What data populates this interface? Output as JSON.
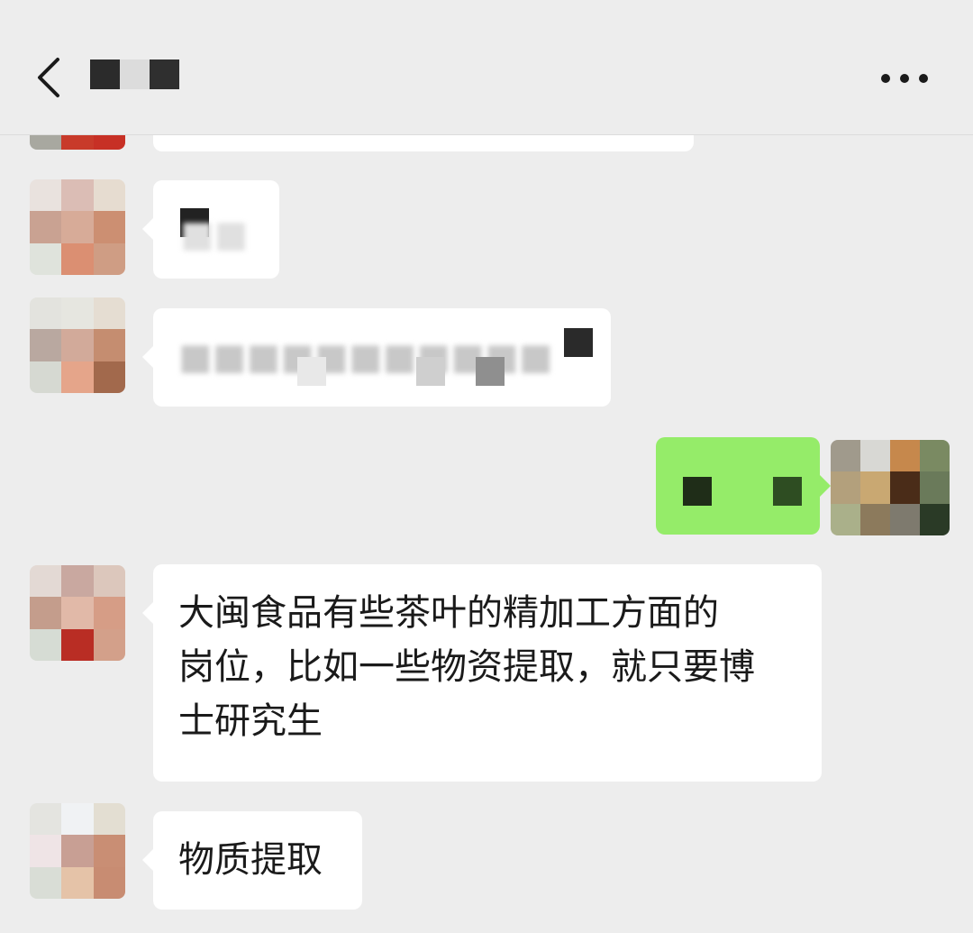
{
  "header": {
    "back_icon": "chevron-left-icon",
    "contact_name": "",
    "more_icon": "more-horizontal-icon"
  },
  "colors": {
    "background": "#ededed",
    "incoming_bubble": "#ffffff",
    "outgoing_bubble": "#95ec69",
    "text": "#1a1a1a"
  },
  "messages": [
    {
      "direction": "in",
      "text": ""
    },
    {
      "direction": "in",
      "text": ""
    },
    {
      "direction": "in",
      "text": ""
    },
    {
      "direction": "out",
      "text": ""
    },
    {
      "direction": "in",
      "lines": [
        "大闽食品有些茶叶的精加工方面的",
        "岗位，比如一些物资提取，就只要博",
        "士研究生"
      ]
    },
    {
      "direction": "in",
      "text": "物质提取"
    }
  ]
}
